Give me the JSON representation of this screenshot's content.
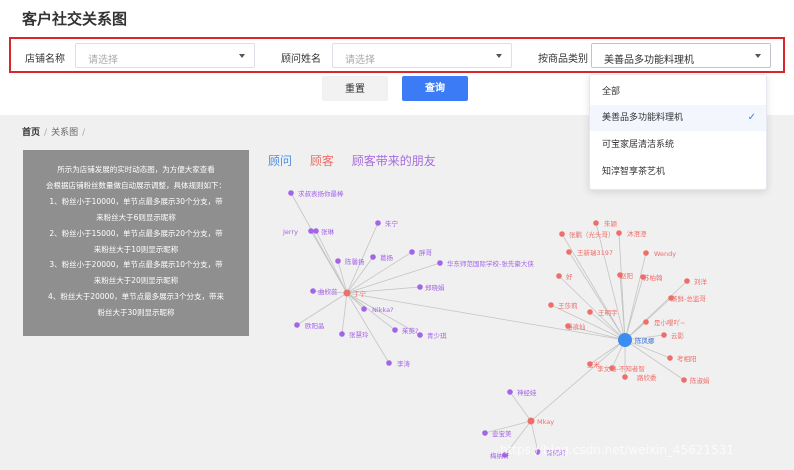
{
  "title": "客户社交关系图",
  "filters": [
    {
      "label": "店铺名称",
      "placeholder": "请选择",
      "value": ""
    },
    {
      "label": "顾问姓名",
      "placeholder": "请选择",
      "value": ""
    },
    {
      "label": "按商品类别",
      "placeholder": "请选择",
      "value": "美善品多功能料理机"
    }
  ],
  "buttons": {
    "reset": "重置",
    "query": "查询"
  },
  "dropdown": {
    "options": [
      "全部",
      "美善品多功能料理机",
      "可宝家居清洁系统",
      "知淳智享茶艺机"
    ],
    "selected_index": 1
  },
  "breadcrumb": {
    "home": "首页",
    "current": "关系图",
    "separator": "/"
  },
  "info": {
    "lines": [
      "所示为店铺发展的实时动态图，为方便大家查看",
      "会根据店铺粉丝数量做自动展示调整，具体规则如下：",
      "1、粉丝小于10000，单节点最多展示30个分支，带",
      "来粉丝大于6则显示昵称",
      "2、粉丝小于15000，单节点最多展示20个分支，带",
      "来粉丝大于10则显示昵称",
      "3、粉丝小于20000，单节点最多展示10个分支，带",
      "来粉丝大于20则显示昵称",
      "4、粉丝大于20000，单节点最多展示3个分支，带来",
      "粉丝大于30则显示昵称"
    ]
  },
  "legend": [
    {
      "label": "顾问",
      "color": "#4e8ee8"
    },
    {
      "label": "顾客",
      "color": "#ee6e6a"
    },
    {
      "label": "顾客带来的朋友",
      "color": "#a66de0"
    }
  ],
  "graph": {
    "colors": {
      "advisor": "#3b8df0",
      "customer": "#ee6e6a",
      "friend": "#a464e8",
      "link": "#c4c4c4"
    },
    "labels": {
      "advisor": "陈凤娜",
      "hub_a": "丁宁",
      "hub_b": "Mkay",
      "friends": [
        "求叔表扬你最棒",
        "Jerry",
        "张琳",
        "朱宁",
        "陈馨扬",
        "葛扬",
        "胖哥",
        "华东师范国际学校-张先豪大侠",
        "曲欣蕊",
        "郑晓娟",
        "Nikka?",
        "欧阳晶",
        "茱萸?",
        "张慧玲",
        "青少琪",
        "李涛",
        "神经娃",
        "壶宝美",
        "梅纳轩",
        "有何的"
      ],
      "customers": [
        "朱颖",
        "张鹏（光头哥）",
        "沐澄澄",
        "王新瑞3197",
        "Wendy",
        "好",
        "赵阳",
        "苏柏翰",
        "刘洋",
        "王莎莉",
        "蒸鲜-总监哥",
        "王明宇",
        "是小嘤吖~",
        "漫浪仙",
        "云影",
        "玉米",
        "考相阳",
        "李文瑞-不知者智",
        "路欣委",
        "陈淑娟"
      ]
    }
  },
  "watermark": "https://blog.csdn.net/weixin_45621531"
}
